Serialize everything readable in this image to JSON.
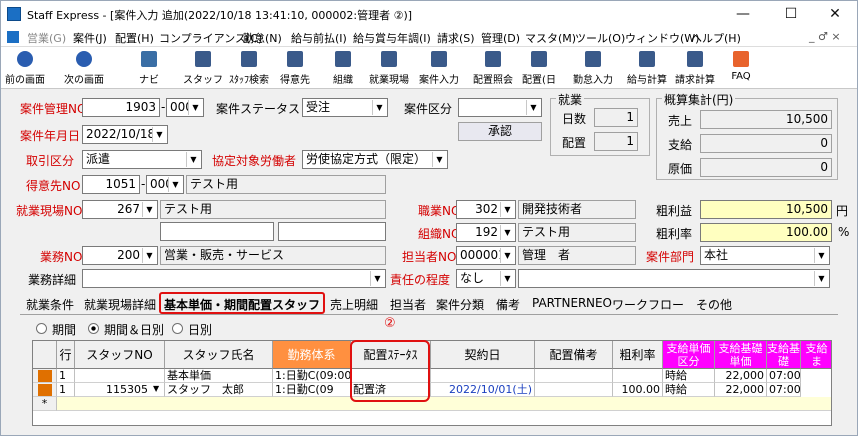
{
  "window": {
    "title": "Staff Express - [案件入力 追加(2022/10/18 13:41:10, 000002:管理者 ②)]",
    "min": "—",
    "max": "☐",
    "close": "✕"
  },
  "menu": {
    "items": [
      "営業(G)",
      "案件(J)",
      "配置(H)",
      "コンプライアンス(C)",
      "勤怠(N)",
      "給与前払(I)",
      "給与賞与年調(I)",
      "請求(S)",
      "管理(D)",
      "マスタ(M)",
      "ツール(O)",
      "ウィンドウ(W)",
      "ヘルプ(H)"
    ],
    "right": "_ ♂ ×"
  },
  "toolbar": {
    "items": [
      "前の画面",
      "次の画面",
      "ナビ",
      "スタッフ",
      "ｽﾀｯﾌ検索",
      "得意先",
      "組織",
      "就業現場",
      "案件入力",
      "配置照会",
      "配置(日",
      "勤怠入力",
      "給与計算",
      "請求計算",
      "FAQ"
    ]
  },
  "form": {
    "case_no_label": "案件管理NO",
    "case_no": "1903",
    "case_sub": "000",
    "case_status_label": "案件ステータス",
    "case_status": "受注",
    "case_kbn_label": "案件区分",
    "case_kbn": "",
    "approve": "承認",
    "date_label": "案件年月日",
    "date": "2022/10/18",
    "trade_label": "取引区分",
    "trade": "派遣",
    "agreement_label": "協定対象労働者",
    "agreement": "労使協定方式（限定）",
    "client_label": "得意先NO",
    "client_no": "1051",
    "client_sub": "000",
    "client_name": "テスト用",
    "site_label": "就業現場NO",
    "site_no": "267",
    "site_name": "テスト用",
    "job_label": "職業NO",
    "job_no": "302",
    "job_name": "開発技術者",
    "org_label": "組織NO",
    "org_no": "192",
    "org_name": "テスト用",
    "work_label": "業務NO",
    "work_no": "200",
    "work_name": "営業・販売・サービス",
    "staff_label": "担当者NO",
    "staff_no": "000001",
    "staff_name": "管理　者",
    "dept_label": "案件部門",
    "dept": "本社",
    "work_detail_label": "業務詳細",
    "work_detail": "",
    "resp_label": "責任の程度",
    "resp": "なし"
  },
  "shugyo": {
    "title": "就業",
    "days_label": "日数",
    "days": "1",
    "haichi_label": "配置",
    "haichi": "1"
  },
  "gaisan": {
    "title": "概算集計(円)",
    "sales_label": "売上",
    "sales": "10,500",
    "pay_label": "支給",
    "pay": "0",
    "cost_label": "原価",
    "cost": "0",
    "profit_label": "粗利益",
    "profit": "10,500",
    "profit_unit": "円",
    "rate_label": "粗利率",
    "rate": "100.00",
    "rate_unit": "%"
  },
  "tabs": [
    "就業条件",
    "就業現場詳細",
    "基本単価・期間配置スタッフ",
    "売上明細",
    "担当者",
    "案件分類",
    "備考",
    "PARTNER",
    "NEO",
    "ワークフロー",
    "その他"
  ],
  "annotation": "②",
  "radios": [
    "期間",
    "期間＆日別",
    "日別"
  ],
  "grid": {
    "headers": [
      "行",
      "スタッフNO",
      "スタッフ氏名",
      "勤務体系",
      "配置ｽﾃｰﾀｽ",
      "契約日",
      "配置備考",
      "粗利率",
      "支給単価区分",
      "支給基礎単価",
      "支給基礎",
      "支給ま"
    ],
    "rows": [
      {
        "row": "1",
        "staff_no": "",
        "staff_name": "基本単価",
        "kinmu": "1:日勤C(09:00",
        "status": "",
        "date": "",
        "note": "",
        "rate": "",
        "kbn": "時給",
        "base": "22,000",
        "time": "07:00"
      },
      {
        "row": "1",
        "staff_no": "115305",
        "staff_name": "スタッフ　太郎",
        "kinmu": "1:日勤C(09",
        "status": "配置済",
        "date": "2022/10/01(土)",
        "note": "",
        "rate": "100.00",
        "kbn": "時給",
        "base": "22,000",
        "time": "07:00"
      }
    ],
    "new_row": "*"
  }
}
